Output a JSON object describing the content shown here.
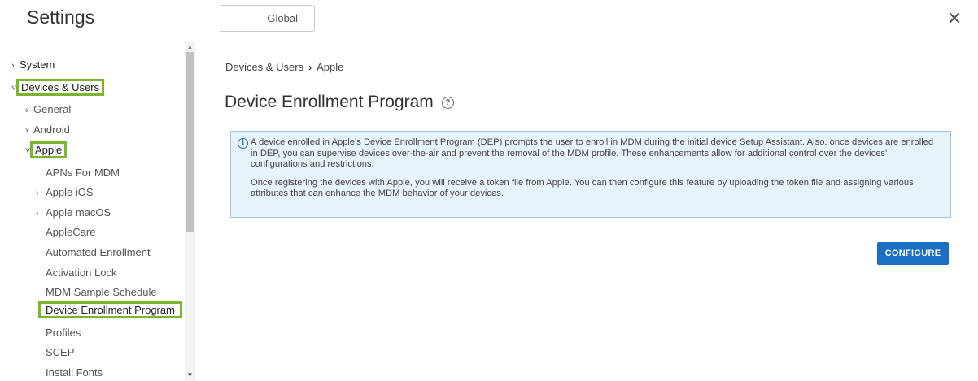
{
  "header": {
    "title": "Settings",
    "scope_button": "Global",
    "close_icon": "close-icon"
  },
  "sidebar": {
    "items": [
      {
        "label": "System",
        "chevron": "›"
      },
      {
        "label": "Devices & Users",
        "chevron": "˅"
      },
      {
        "label": "General",
        "chevron": "›"
      },
      {
        "label": "Android",
        "chevron": "›"
      },
      {
        "label": "Apple",
        "chevron": "˅"
      },
      {
        "label": "APNs For MDM"
      },
      {
        "label": "Apple iOS",
        "chevron": "›"
      },
      {
        "label": "Apple macOS",
        "chevron": "›"
      },
      {
        "label": "AppleCare"
      },
      {
        "label": "Automated Enrollment"
      },
      {
        "label": "Activation Lock"
      },
      {
        "label": "MDM Sample Schedule"
      },
      {
        "label": "Device Enrollment Program"
      },
      {
        "label": "Profiles"
      },
      {
        "label": "SCEP"
      },
      {
        "label": "Install Fonts"
      }
    ],
    "highlight_color": "#7ab52a"
  },
  "breadcrumb": {
    "parent": "Devices & Users",
    "separator": "›",
    "current": "Apple"
  },
  "page": {
    "title": "Device Enrollment Program",
    "help_icon": "help-icon"
  },
  "info": {
    "icon": "info-icon",
    "paragraph1": "A device enrolled in Apple's Device Enrollment Program (DEP) prompts the user to enroll in MDM during the initial device Setup Assistant. Also, once devices are enrolled in DEP, you can supervise devices over-the-air and prevent the removal of the MDM profile. These enhancements allow for additional control over the devices' configurations and restrictions.",
    "paragraph2": "Once registering the devices with Apple, you will receive a token file from Apple. You can then configure this feature by uploading the token file and assigning various attributes that can enhance the MDM behavior of your devices."
  },
  "actions": {
    "configure_label": "CONFIGURE",
    "accent": "#1a6fc3"
  }
}
